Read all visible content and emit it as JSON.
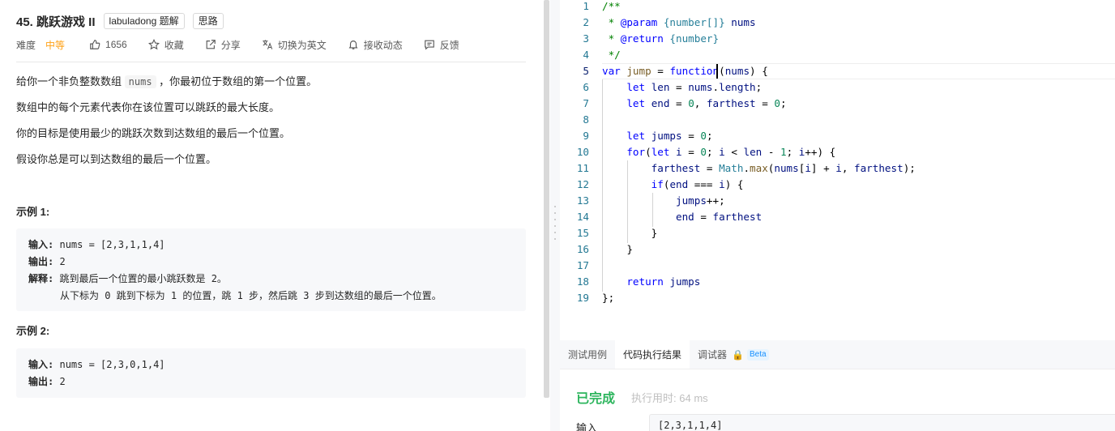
{
  "problem": {
    "title": "45. 跳跃游戏 II",
    "tags": [
      "labuladong 题解",
      "思路"
    ],
    "difficulty_label": "难度",
    "difficulty": "中等",
    "likes": "1656",
    "favorite": "收藏",
    "share": "分享",
    "switch_lang": "切换为英文",
    "subscribe": "接收动态",
    "feedback": "反馈",
    "desc_1a": "给你一个非负整数数组",
    "desc_1_code": "nums",
    "desc_1b": "，你最初位于数组的第一个位置。",
    "desc_2": "数组中的每个元素代表你在该位置可以跳跃的最大长度。",
    "desc_3": "你的目标是使用最少的跳跃次数到达数组的最后一个位置。",
    "desc_4": "假设你总是可以到达数组的最后一个位置。",
    "examples": [
      {
        "title": "示例 1:",
        "input_label": "输入:",
        "input": "nums = [2,3,1,1,4]",
        "output_label": "输出:",
        "output": "2",
        "explain_label": "解释:",
        "explain_1": "跳到最后一个位置的最小跳跃数是 2。",
        "explain_2": "从下标为 0 跳到下标为 1 的位置，跳 1 步，然后跳 3 步到达数组的最后一个位置。"
      },
      {
        "title": "示例 2:",
        "input_label": "输入:",
        "input": "nums = [2,3,0,1,4]",
        "output_label": "输出:",
        "output": "2"
      }
    ]
  },
  "editor": {
    "line_numbers": [
      "1",
      "2",
      "3",
      "4",
      "5",
      "6",
      "7",
      "8",
      "9",
      "10",
      "11",
      "12",
      "13",
      "14",
      "15",
      "16",
      "17",
      "18",
      "19"
    ],
    "active_line": "5"
  },
  "bottom_panel": {
    "tabs": [
      "测试用例",
      "代码执行结果",
      "调试器"
    ],
    "beta": "Beta",
    "status": "已完成",
    "time_label": "执行用时:",
    "time_value": "64 ms",
    "input_label": "输入",
    "input_value": "[2,3,1,1,4]"
  },
  "colors": {
    "accent": "#ffa116",
    "success": "#2db55d",
    "keyword": "#0000ff",
    "comment": "#008000"
  }
}
